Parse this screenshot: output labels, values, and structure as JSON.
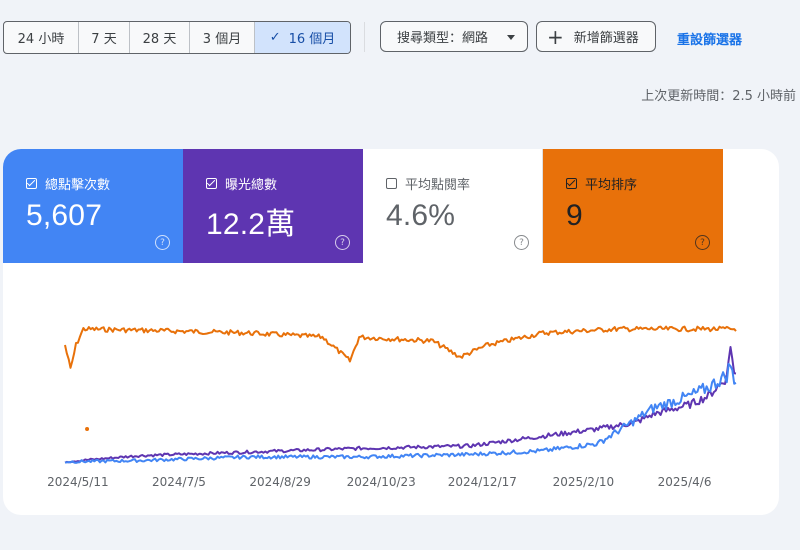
{
  "filters": {
    "ranges": [
      {
        "label": "24 小時",
        "selected": false
      },
      {
        "label": "7 天",
        "selected": false
      },
      {
        "label": "28 天",
        "selected": false
      },
      {
        "label": "3 個月",
        "selected": false
      },
      {
        "label": "16 個月",
        "selected": true
      }
    ],
    "search_type": "搜尋類型：網路",
    "add_filter": "新增篩選器",
    "reset": "重設篩選器"
  },
  "last_updated": "上次更新時間：2.5 小時前",
  "metrics": {
    "clicks": {
      "label": "總點擊次數",
      "value": "5,607",
      "checked": true,
      "color": "#4285f4"
    },
    "impressions": {
      "label": "曝光總數",
      "value": "12.2萬",
      "checked": true,
      "color": "#5e35b1"
    },
    "ctr": {
      "label": "平均點閱率",
      "value": "4.6%",
      "checked": false,
      "color": "#ffffff"
    },
    "position": {
      "label": "平均排序",
      "value": "9",
      "checked": true,
      "color": "#e8710a"
    }
  },
  "chart_data": {
    "type": "line",
    "x_tick_labels": [
      "2024/5/11",
      "2024/7/5",
      "2024/8/29",
      "2024/10/23",
      "2024/12/17",
      "2025/2/10",
      "2025/4/6"
    ],
    "x_range": [
      "2024/5/4",
      "2025/4/29"
    ],
    "series": [
      {
        "name": "總點擊次數",
        "color": "#4285f4",
        "keypoints_relative": [
          [
            0,
            0.01
          ],
          [
            40,
            0.02
          ],
          [
            100,
            0.05
          ],
          [
            160,
            0.05
          ],
          [
            220,
            0.07
          ],
          [
            260,
            0.1
          ],
          [
            290,
            0.16
          ],
          [
            310,
            0.35
          ],
          [
            320,
            0.45
          ],
          [
            340,
            0.55
          ],
          [
            350,
            0.62
          ],
          [
            360,
            0.72
          ],
          [
            362,
            0.82
          ],
          [
            364,
            0.64
          ],
          [
            365,
            0.7
          ]
        ]
      },
      {
        "name": "曝光總數",
        "color": "#5e35b1",
        "keypoints_relative": [
          [
            0,
            0.01
          ],
          [
            40,
            0.06
          ],
          [
            100,
            0.09
          ],
          [
            160,
            0.12
          ],
          [
            220,
            0.14
          ],
          [
            260,
            0.22
          ],
          [
            290,
            0.28
          ],
          [
            310,
            0.33
          ],
          [
            320,
            0.4
          ],
          [
            340,
            0.48
          ],
          [
            350,
            0.55
          ],
          [
            360,
            0.7
          ],
          [
            362,
            0.98
          ],
          [
            364,
            0.72
          ],
          [
            365,
            0.73
          ]
        ]
      },
      {
        "name": "平均排序",
        "color": "#e8710a",
        "inverted": true,
        "keypoints_relative": [
          [
            0,
            0.3
          ],
          [
            3,
            0.6
          ],
          [
            6,
            0.3
          ],
          [
            10,
            0.1
          ],
          [
            50,
            0.12
          ],
          [
            100,
            0.15
          ],
          [
            140,
            0.2
          ],
          [
            155,
            0.5
          ],
          [
            160,
            0.2
          ],
          [
            200,
            0.25
          ],
          [
            215,
            0.45
          ],
          [
            230,
            0.3
          ],
          [
            260,
            0.15
          ],
          [
            300,
            0.1
          ],
          [
            365,
            0.1
          ]
        ]
      }
    ]
  }
}
